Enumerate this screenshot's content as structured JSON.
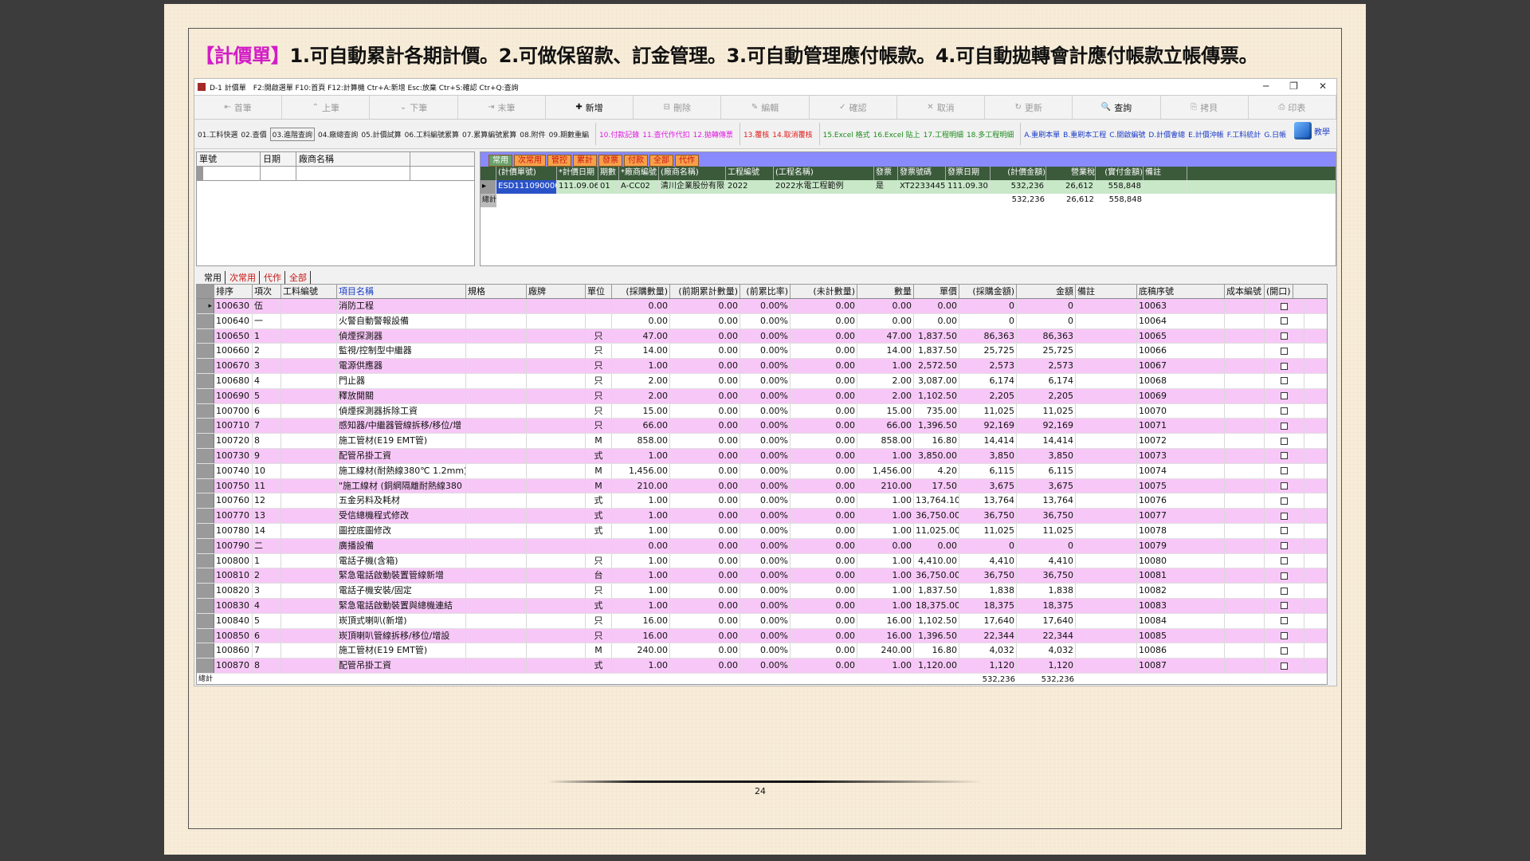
{
  "headline": {
    "bracket": "【計價單】",
    "text": "1.可自動累計各期計價。2.可做保留款、訂金管理。3.可自動管理應付帳款。4.可自動拋轉會計應付帳款立帳傳票。"
  },
  "window": {
    "title": "D-1 計價單　F2:開啟選單 F10:首頁 F12:計算機 Ctr+A:新增 Esc:放棄 Ctr+S:確認 Ctr+Q:查詢",
    "controls": [
      "─",
      "❐",
      "✕"
    ]
  },
  "toolbar": [
    {
      "label": "首筆",
      "icon": "⇤",
      "on": false
    },
    {
      "label": "上筆",
      "icon": "⌃",
      "on": false
    },
    {
      "label": "下筆",
      "icon": "⌄",
      "on": false
    },
    {
      "label": "末筆",
      "icon": "⇥",
      "on": false
    },
    {
      "label": "新增",
      "icon": "✚",
      "on": true
    },
    {
      "label": "刪除",
      "icon": "⊟",
      "on": false
    },
    {
      "label": "編輯",
      "icon": "✎",
      "on": false
    },
    {
      "label": "確認",
      "icon": "✓",
      "on": false
    },
    {
      "label": "取消",
      "icon": "✕",
      "on": false
    },
    {
      "label": "更新",
      "icon": "↻",
      "on": false
    },
    {
      "label": "查詢",
      "icon": "🔍",
      "on": true
    },
    {
      "label": "拷貝",
      "icon": "⎘",
      "on": false
    },
    {
      "label": "印表",
      "icon": "⎙",
      "on": false
    }
  ],
  "funcbar": {
    "g0": [
      "01.工料快選",
      "02.查價",
      "03.進階查詢",
      "04.廠總查詢",
      "05.計價試算",
      "06.工料編號累算",
      "07.累算編號累算",
      "08.附件",
      "09.期數重編"
    ],
    "g1": [
      "10.付款記錄",
      "11.查代作代扣",
      "12.拋轉傳票"
    ],
    "g2": [
      "13.覆核",
      "14.取消覆核"
    ],
    "g3": [
      "15.Excel 格式",
      "16.Excel 貼上",
      "17.工程明細",
      "18.多工程明細"
    ],
    "g4": [
      "A.重刷本單",
      "B.重刷本工程",
      "C.開啟編號",
      "D.計價會總",
      "E.計價沖帳",
      "F.工料統計",
      "G.日帳"
    ],
    "help": "教學"
  },
  "left": {
    "headers": [
      "單號",
      "日期",
      "廠商名稱"
    ]
  },
  "right": {
    "tabs": [
      "常用",
      "次常用",
      "管控",
      "累計",
      "發票",
      "付款",
      "全部",
      "代作"
    ],
    "headers": [
      "(計價單號)",
      "*計價日期",
      "期數",
      "*廠商編號",
      "(廠商名稱)",
      "工程編號",
      "(工程名稱)",
      "發票",
      "發票號碼",
      "發票日期",
      "(計價金額)",
      "營業稅",
      "(實付金額)",
      "備註"
    ],
    "row": [
      "ESD1110900008",
      "111.09.06",
      "01",
      "A-CC02",
      "清川企業股份有限公司",
      "2022",
      "2022水電工程範例",
      "是",
      "XT22334455",
      "111.09.30",
      "532,236",
      "26,612",
      "558,848",
      ""
    ],
    "sum": {
      "label": "總計",
      "amount": "532,236",
      "tax": "26,612",
      "paid": "558,848"
    }
  },
  "bottom_tabs": [
    "常用",
    "次常用",
    "代作",
    "全部"
  ],
  "grid": {
    "headers": [
      "排序",
      "項次",
      "工料編號",
      "項目名稱",
      "規格",
      "廠牌",
      "單位",
      "(採購數量)",
      "(前期累計數量)",
      "(前累比率)",
      "(未計數量)",
      "數量",
      "單價",
      "(採購金額)",
      "金額",
      "備註",
      "底稿序號",
      "成本編號",
      "(開口)"
    ],
    "rows": [
      [
        "100630",
        "伍",
        "",
        "消防工程",
        "",
        "",
        "",
        "0.00",
        "0.00",
        "0.00%",
        "0.00",
        "0.00",
        "0.00",
        "0",
        "0",
        "",
        "10063",
        ""
      ],
      [
        "100640",
        "一",
        "",
        "火警自動警報設備",
        "",
        "",
        "",
        "0.00",
        "0.00",
        "0.00%",
        "0.00",
        "0.00",
        "0.00",
        "0",
        "0",
        "",
        "10064",
        ""
      ],
      [
        "100650",
        "1",
        "",
        "偵煙探測器",
        "",
        "",
        "只",
        "47.00",
        "0.00",
        "0.00%",
        "0.00",
        "47.00",
        "1,837.50",
        "86,363",
        "86,363",
        "",
        "10065",
        ""
      ],
      [
        "100660",
        "2",
        "",
        "監視/控制型中繼器",
        "",
        "",
        "只",
        "14.00",
        "0.00",
        "0.00%",
        "0.00",
        "14.00",
        "1,837.50",
        "25,725",
        "25,725",
        "",
        "10066",
        ""
      ],
      [
        "100670",
        "3",
        "",
        "電源供應器",
        "",
        "",
        "只",
        "1.00",
        "0.00",
        "0.00%",
        "0.00",
        "1.00",
        "2,572.50",
        "2,573",
        "2,573",
        "",
        "10067",
        ""
      ],
      [
        "100680",
        "4",
        "",
        "門止器",
        "",
        "",
        "只",
        "2.00",
        "0.00",
        "0.00%",
        "0.00",
        "2.00",
        "3,087.00",
        "6,174",
        "6,174",
        "",
        "10068",
        ""
      ],
      [
        "100690",
        "5",
        "",
        "釋放開關",
        "",
        "",
        "只",
        "2.00",
        "0.00",
        "0.00%",
        "0.00",
        "2.00",
        "1,102.50",
        "2,205",
        "2,205",
        "",
        "10069",
        ""
      ],
      [
        "100700",
        "6",
        "",
        "偵煙探測器拆除工資",
        "",
        "",
        "只",
        "15.00",
        "0.00",
        "0.00%",
        "0.00",
        "15.00",
        "735.00",
        "11,025",
        "11,025",
        "",
        "10070",
        ""
      ],
      [
        "100710",
        "7",
        "",
        "感知器/中繼器管線拆移/移位/增",
        "",
        "",
        "只",
        "66.00",
        "0.00",
        "0.00%",
        "0.00",
        "66.00",
        "1,396.50",
        "92,169",
        "92,169",
        "",
        "10071",
        ""
      ],
      [
        "100720",
        "8",
        "",
        "施工管材(E19 EMT管)",
        "",
        "",
        "M",
        "858.00",
        "0.00",
        "0.00%",
        "0.00",
        "858.00",
        "16.80",
        "14,414",
        "14,414",
        "",
        "10072",
        ""
      ],
      [
        "100730",
        "9",
        "",
        "配管吊掛工資",
        "",
        "",
        "式",
        "1.00",
        "0.00",
        "0.00%",
        "0.00",
        "1.00",
        "3,850.00",
        "3,850",
        "3,850",
        "",
        "10073",
        ""
      ],
      [
        "100740",
        "10",
        "",
        "施工線材(耐熱線380℃ 1.2mm)",
        "",
        "",
        "M",
        "1,456.00",
        "0.00",
        "0.00%",
        "0.00",
        "1,456.00",
        "4.20",
        "6,115",
        "6,115",
        "",
        "10074",
        ""
      ],
      [
        "100750",
        "11",
        "",
        "\"施工線材 (銅網隔離耐熱線380",
        "",
        "",
        "M",
        "210.00",
        "0.00",
        "0.00%",
        "0.00",
        "210.00",
        "17.50",
        "3,675",
        "3,675",
        "",
        "10075",
        ""
      ],
      [
        "100760",
        "12",
        "",
        "五金另料及耗材",
        "",
        "",
        "式",
        "1.00",
        "0.00",
        "0.00%",
        "0.00",
        "1.00",
        "13,764.10",
        "13,764",
        "13,764",
        "",
        "10076",
        ""
      ],
      [
        "100770",
        "13",
        "",
        "受信總機程式修改",
        "",
        "",
        "式",
        "1.00",
        "0.00",
        "0.00%",
        "0.00",
        "1.00",
        "36,750.00",
        "36,750",
        "36,750",
        "",
        "10077",
        ""
      ],
      [
        "100780",
        "14",
        "",
        "圖控底圖修改",
        "",
        "",
        "式",
        "1.00",
        "0.00",
        "0.00%",
        "0.00",
        "1.00",
        "11,025.00",
        "11,025",
        "11,025",
        "",
        "10078",
        ""
      ],
      [
        "100790",
        "二",
        "",
        "廣播設備",
        "",
        "",
        "",
        "0.00",
        "0.00",
        "0.00%",
        "0.00",
        "0.00",
        "0.00",
        "0",
        "0",
        "",
        "10079",
        ""
      ],
      [
        "100800",
        "1",
        "",
        "電話子機(含箱)",
        "",
        "",
        "只",
        "1.00",
        "0.00",
        "0.00%",
        "0.00",
        "1.00",
        "4,410.00",
        "4,410",
        "4,410",
        "",
        "10080",
        ""
      ],
      [
        "100810",
        "2",
        "",
        "緊急電話啟動裝置管線新增",
        "",
        "",
        "台",
        "1.00",
        "0.00",
        "0.00%",
        "0.00",
        "1.00",
        "36,750.00",
        "36,750",
        "36,750",
        "",
        "10081",
        ""
      ],
      [
        "100820",
        "3",
        "",
        "電話子機安裝/固定",
        "",
        "",
        "只",
        "1.00",
        "0.00",
        "0.00%",
        "0.00",
        "1.00",
        "1,837.50",
        "1,838",
        "1,838",
        "",
        "10082",
        ""
      ],
      [
        "100830",
        "4",
        "",
        "緊急電話啟動裝置與總機連結",
        "",
        "",
        "式",
        "1.00",
        "0.00",
        "0.00%",
        "0.00",
        "1.00",
        "18,375.00",
        "18,375",
        "18,375",
        "",
        "10083",
        ""
      ],
      [
        "100840",
        "5",
        "",
        "崁頂式喇叭(新增)",
        "",
        "",
        "只",
        "16.00",
        "0.00",
        "0.00%",
        "0.00",
        "16.00",
        "1,102.50",
        "17,640",
        "17,640",
        "",
        "10084",
        ""
      ],
      [
        "100850",
        "6",
        "",
        "崁頂喇叭管線拆移/移位/增設",
        "",
        "",
        "只",
        "16.00",
        "0.00",
        "0.00%",
        "0.00",
        "16.00",
        "1,396.50",
        "22,344",
        "22,344",
        "",
        "10085",
        ""
      ],
      [
        "100860",
        "7",
        "",
        "施工管材(E19 EMT管)",
        "",
        "",
        "M",
        "240.00",
        "0.00",
        "0.00%",
        "0.00",
        "240.00",
        "16.80",
        "4,032",
        "4,032",
        "",
        "10086",
        ""
      ],
      [
        "100870",
        "8",
        "",
        "配管吊掛工資",
        "",
        "",
        "式",
        "1.00",
        "0.00",
        "0.00%",
        "0.00",
        "1.00",
        "1,120.00",
        "1,120",
        "1,120",
        "",
        "10087",
        ""
      ]
    ],
    "foot": {
      "label": "總計",
      "purchase_total": "532,236",
      "amount_total": "532,236"
    }
  },
  "page_number": "24"
}
